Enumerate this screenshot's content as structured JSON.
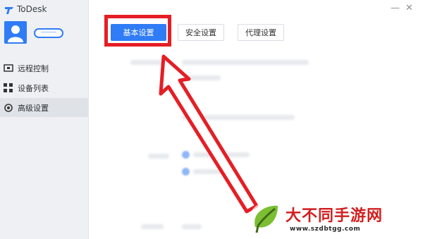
{
  "app": {
    "title": "ToDesk"
  },
  "sidebar": {
    "items": [
      {
        "label": "远程控制",
        "icon": "monitor-icon",
        "active": false
      },
      {
        "label": "设备列表",
        "icon": "grid-icon",
        "active": false
      },
      {
        "label": "高级设置",
        "icon": "gear-icon",
        "active": true
      }
    ]
  },
  "window": {
    "minimize": "—",
    "close": "✕"
  },
  "tabs": [
    {
      "label": "基本设置",
      "active": true
    },
    {
      "label": "安全设置",
      "active": false
    },
    {
      "label": "代理设置",
      "active": false
    }
  ],
  "colors": {
    "accent": "#2f7cf6",
    "annotation": "#e51e25",
    "sidebar_bg": "#eef0f3"
  },
  "watermark": {
    "brand": "大不同手游网",
    "url": "www.szdbtgg.com"
  }
}
